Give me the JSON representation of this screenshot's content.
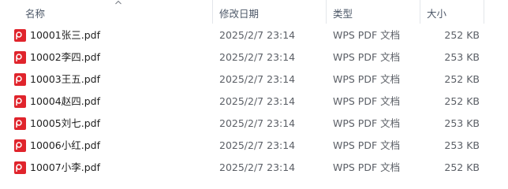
{
  "columns": {
    "name": "名称",
    "modified": "修改日期",
    "type": "类型",
    "size": "大小"
  },
  "sort": {
    "column": "name",
    "icon": "sort-up-chevron-icon"
  },
  "file_icon": "pdf-file-icon",
  "colors": {
    "pdf_icon": "#e0242c",
    "header_text": "#4d5868",
    "row_text": "#1f1f1f",
    "muted_text": "#5b5f66"
  },
  "files": [
    {
      "name": "10001张三.pdf",
      "modified": "2025/2/7 23:14",
      "type": "WPS PDF 文档",
      "size": "252 KB"
    },
    {
      "name": "10002李四.pdf",
      "modified": "2025/2/7 23:14",
      "type": "WPS PDF 文档",
      "size": "253 KB"
    },
    {
      "name": "10003王五.pdf",
      "modified": "2025/2/7 23:14",
      "type": "WPS PDF 文档",
      "size": "252 KB"
    },
    {
      "name": "10004赵四.pdf",
      "modified": "2025/2/7 23:14",
      "type": "WPS PDF 文档",
      "size": "252 KB"
    },
    {
      "name": "10005刘七.pdf",
      "modified": "2025/2/7 23:14",
      "type": "WPS PDF 文档",
      "size": "253 KB"
    },
    {
      "name": "10006小红.pdf",
      "modified": "2025/2/7 23:14",
      "type": "WPS PDF 文档",
      "size": "253 KB"
    },
    {
      "name": "10007小李.pdf",
      "modified": "2025/2/7 23:14",
      "type": "WPS PDF 文档",
      "size": "252 KB"
    }
  ]
}
